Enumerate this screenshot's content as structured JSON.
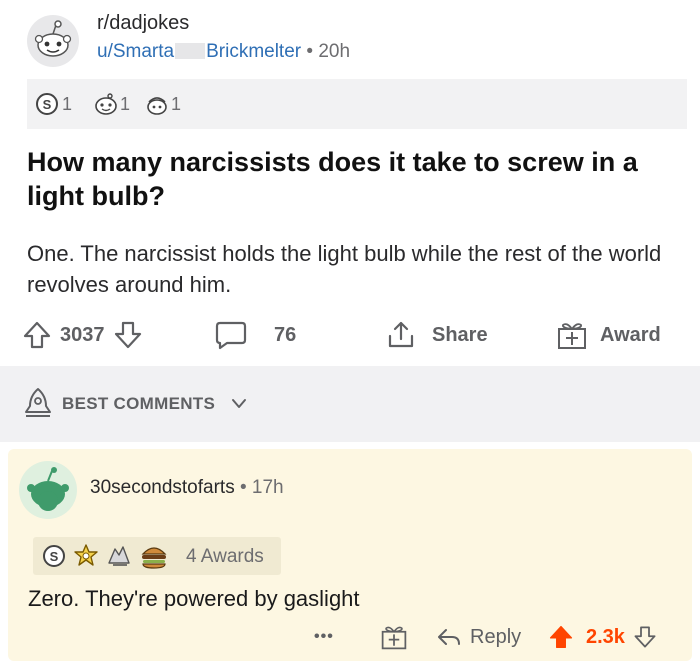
{
  "post": {
    "subreddit": "r/dadjokes",
    "username_start": "u/Smarta",
    "username_end": "Brickmelter",
    "separator": "•",
    "age": "20h",
    "awards": [
      {
        "icon": "silver-award-icon",
        "count": "1"
      },
      {
        "icon": "wholesome-award-icon",
        "count": "1"
      },
      {
        "icon": "helpful-award-icon",
        "count": "1"
      }
    ],
    "title": "How many narcissists does it take to screw in a light bulb?",
    "body": "One. The narcissist holds the light bulb while the rest of the world revolves around him.",
    "votes": "3037",
    "comments": "76",
    "share_label": "Share",
    "award_label": "Award"
  },
  "sort": {
    "label": "BEST COMMENTS"
  },
  "comment": {
    "username": "30secondstofarts",
    "separator": "•",
    "age": "17h",
    "awards_label": "4 Awards",
    "award_icons": [
      "silver-award-icon",
      "gold-award-icon",
      "take-my-energy-award-icon",
      "burger-award-icon"
    ],
    "text": "Zero. They're powered by gaslight",
    "more": "•••",
    "reply_label": "Reply",
    "score": "2.3k",
    "upvote_color": "#ff4500"
  }
}
